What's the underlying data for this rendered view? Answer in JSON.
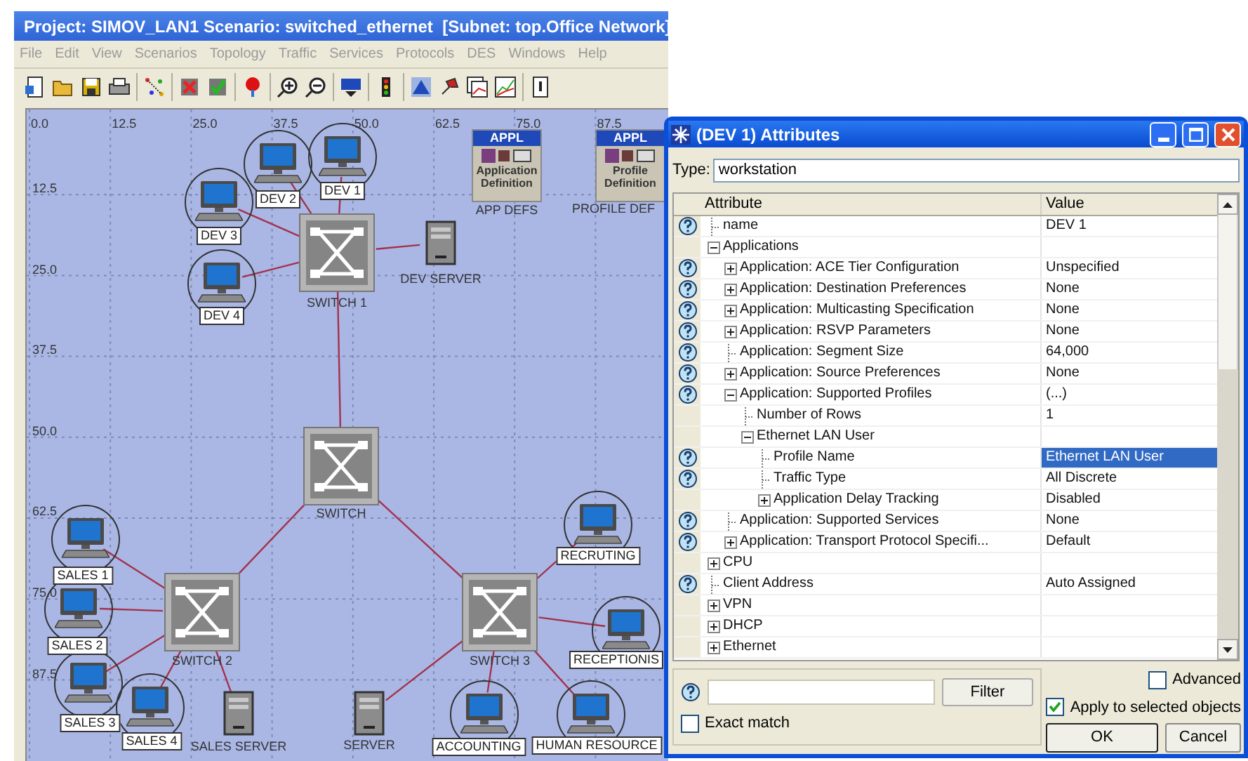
{
  "window": {
    "title": "Project: SIMOV_LAN1 Scenario: switched_ethernet  [Subnet: top.Office Network]"
  },
  "menu": [
    {
      "label": "File",
      "disabled": true
    },
    {
      "label": "Edit",
      "disabled": true
    },
    {
      "label": "View",
      "disabled": true
    },
    {
      "label": "Scenarios",
      "disabled": true
    },
    {
      "label": "Topology",
      "disabled": true
    },
    {
      "label": "Traffic",
      "disabled": true
    },
    {
      "label": "Services",
      "disabled": true
    },
    {
      "label": "Protocols",
      "disabled": true
    },
    {
      "label": "DES",
      "disabled": true
    },
    {
      "label": "Windows",
      "disabled": true
    },
    {
      "label": "Help",
      "disabled": true
    }
  ],
  "canvas": {
    "x_ticks": [
      "0.0",
      "12.5",
      "25.0",
      "37.5",
      "50.0",
      "62.5",
      "75.0",
      "87.5"
    ],
    "y_ticks": [
      "12.5",
      "25.0",
      "37.5",
      "50.0",
      "62.5",
      "75.0",
      "87.5"
    ],
    "nodes": [
      {
        "kind": "workstation",
        "label": "DEV 1",
        "selected": true
      },
      {
        "kind": "workstation",
        "label": "DEV 2",
        "selected": true
      },
      {
        "kind": "workstation",
        "label": "DEV 3",
        "selected": true
      },
      {
        "kind": "workstation",
        "label": "DEV 4",
        "selected": true
      },
      {
        "kind": "switch",
        "label": "SWITCH 1",
        "selected": false
      },
      {
        "kind": "server",
        "label": "DEV SERVER",
        "selected": false
      },
      {
        "kind": "definition",
        "label": "APP DEFS",
        "header": "APPL",
        "caption": "Application Definition",
        "selected": false
      },
      {
        "kind": "definition",
        "label": "PROFILE DEF",
        "header": "APPL",
        "caption": "Profile Definition",
        "selected": false
      },
      {
        "kind": "switch",
        "label": "SWITCH",
        "selected": false
      },
      {
        "kind": "switch",
        "label": "SWITCH 2",
        "selected": false
      },
      {
        "kind": "switch",
        "label": "SWITCH 3",
        "selected": false
      },
      {
        "kind": "workstation",
        "label": "SALES 1",
        "selected": true
      },
      {
        "kind": "workstation",
        "label": "SALES 2",
        "selected": true
      },
      {
        "kind": "workstation",
        "label": "SALES 3",
        "selected": true
      },
      {
        "kind": "workstation",
        "label": "SALES 4",
        "selected": true
      },
      {
        "kind": "server",
        "label": "SALES SERVER",
        "selected": false
      },
      {
        "kind": "server",
        "label": "SERVER",
        "selected": false
      },
      {
        "kind": "workstation",
        "label": "RECRUTING",
        "selected": true
      },
      {
        "kind": "workstation",
        "label": "RECEPTIONIS",
        "selected": true
      },
      {
        "kind": "workstation",
        "label": "ACCOUNTING",
        "selected": true
      },
      {
        "kind": "workstation",
        "label": "HUMAN RESOURCE",
        "selected": true
      }
    ]
  },
  "dialog": {
    "title": "(DEV 1) Attributes",
    "type_label": "Type:",
    "type_value": "workstation",
    "columns": [
      "Attribute",
      "Value"
    ],
    "rows": [
      {
        "attribute": "name",
        "value": "DEV 1",
        "help": true,
        "kind": "leaf",
        "selected": false
      },
      {
        "attribute": "Applications",
        "help": false,
        "kind": "group",
        "expanded": true,
        "selected": false,
        "children": [
          {
            "attribute": "Application: ACE Tier Configuration",
            "value": "Unspecified",
            "help": true,
            "kind": "group",
            "expanded": false,
            "selected": false
          },
          {
            "attribute": "Application: Destination Preferences",
            "value": "None",
            "help": true,
            "kind": "group",
            "expanded": false,
            "selected": false
          },
          {
            "attribute": "Application: Multicasting Specification",
            "value": "None",
            "help": true,
            "kind": "group",
            "expanded": false,
            "selected": false
          },
          {
            "attribute": "Application: RSVP Parameters",
            "value": "None",
            "help": true,
            "kind": "group",
            "expanded": false,
            "selected": false
          },
          {
            "attribute": "Application: Segment Size",
            "value": "64,000",
            "help": true,
            "kind": "leaf",
            "selected": false
          },
          {
            "attribute": "Application: Source Preferences",
            "value": "None",
            "help": true,
            "kind": "group",
            "expanded": false,
            "selected": false
          },
          {
            "attribute": "Application: Supported Profiles",
            "value": "(...)",
            "help": true,
            "kind": "group",
            "expanded": true,
            "selected": false,
            "children": [
              {
                "attribute": "Number of Rows",
                "value": "1",
                "help": false,
                "kind": "leaf",
                "selected": false
              },
              {
                "attribute": "Ethernet LAN User",
                "help": false,
                "kind": "group",
                "expanded": true,
                "selected": false,
                "children": [
                  {
                    "attribute": "Profile Name",
                    "value": "Ethernet LAN User",
                    "help": true,
                    "kind": "leaf",
                    "selected": true
                  },
                  {
                    "attribute": "Traffic Type",
                    "value": "All Discrete",
                    "help": true,
                    "kind": "leaf",
                    "selected": false
                  },
                  {
                    "attribute": "Application Delay Tracking",
                    "value": "Disabled",
                    "help": false,
                    "kind": "group",
                    "expanded": false,
                    "selected": false
                  }
                ]
              }
            ]
          },
          {
            "attribute": "Application: Supported Services",
            "value": "None",
            "help": true,
            "kind": "leaf",
            "selected": false
          },
          {
            "attribute": "Application: Transport Protocol Specifi...",
            "value": "Default",
            "help": true,
            "kind": "group",
            "expanded": false,
            "selected": false
          }
        ]
      },
      {
        "attribute": "CPU",
        "help": false,
        "kind": "group",
        "expanded": false,
        "selected": false
      },
      {
        "attribute": "Client Address",
        "value": "Auto Assigned",
        "help": true,
        "kind": "leaf",
        "selected": false
      },
      {
        "attribute": "VPN",
        "help": false,
        "kind": "group",
        "expanded": false,
        "selected": false
      },
      {
        "attribute": "DHCP",
        "help": false,
        "kind": "group",
        "expanded": false,
        "selected": false
      },
      {
        "attribute": "Ethernet",
        "help": false,
        "kind": "group",
        "expanded": false,
        "selected": false
      }
    ],
    "filter_button": "Filter",
    "exact_match": {
      "label": "Exact match",
      "checked": false
    },
    "advanced": {
      "label": "Advanced",
      "checked": false
    },
    "apply_selected": {
      "label": "Apply to selected objects",
      "checked": true
    },
    "buttons": [
      "OK",
      "Cancel"
    ]
  }
}
